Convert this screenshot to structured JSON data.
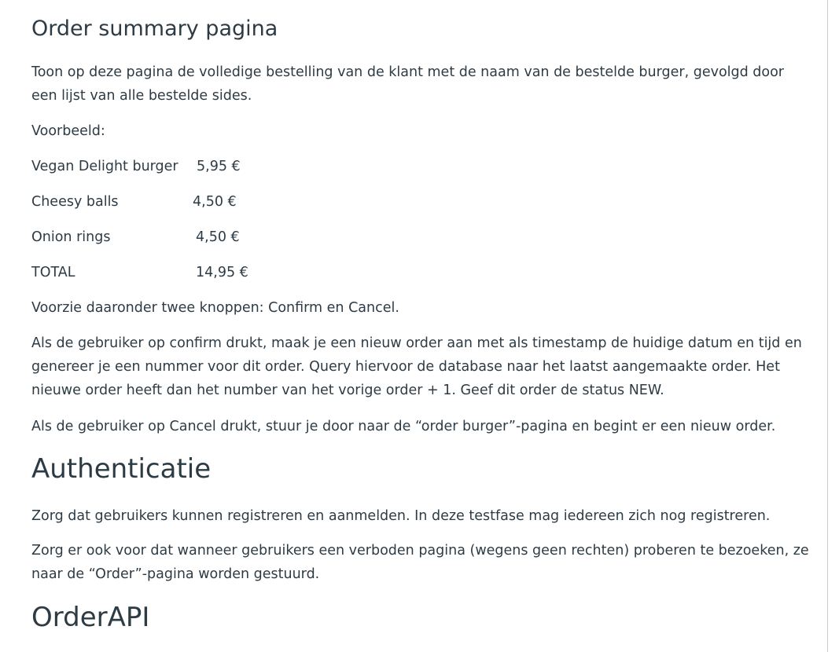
{
  "sections": {
    "order_summary": {
      "heading": "Order summary pagina",
      "intro": "Toon op deze pagina de volledige bestelling van de klant met de naam van de bestelde burger, gevolgd door een lijst van alle bestelde sides.",
      "example_label": "Voorbeeld:",
      "example_rows": [
        {
          "name": "Vegan Delight burger",
          "price": "5,95 €"
        },
        {
          "name": "Cheesy balls",
          "price": "4,50 €"
        },
        {
          "name": "Onion rings",
          "price": "4,50 €"
        },
        {
          "name": "TOTAL",
          "price": "14,95 €"
        }
      ],
      "buttons_text": "Voorzie daaronder twee knoppen: Confirm en Cancel.",
      "confirm_text": "Als de gebruiker op confirm drukt, maak je een nieuw order aan met als timestamp de huidige datum en tijd en genereer je een nummer voor dit order. Query hiervoor de database naar het laatst aangemaakte order. Het nieuwe order heeft dan het number van het vorige order + 1. Geef dit order de status NEW.",
      "cancel_text": "Als de gebruiker op Cancel drukt, stuur je door naar de “order burger”-pagina en begint er een nieuw order."
    },
    "authenticatie": {
      "heading": "Authenticatie",
      "p1": "Zorg dat gebruikers kunnen registreren en aanmelden. In deze testfase mag iedereen zich nog registreren.",
      "p2": "Zorg er ook voor dat wanneer gebruikers een verboden pagina (wegens geen rechten) proberen te bezoeken, ze naar de “Order”-pagina worden gestuurd."
    },
    "orderapi": {
      "heading": "OrderAPI"
    }
  }
}
